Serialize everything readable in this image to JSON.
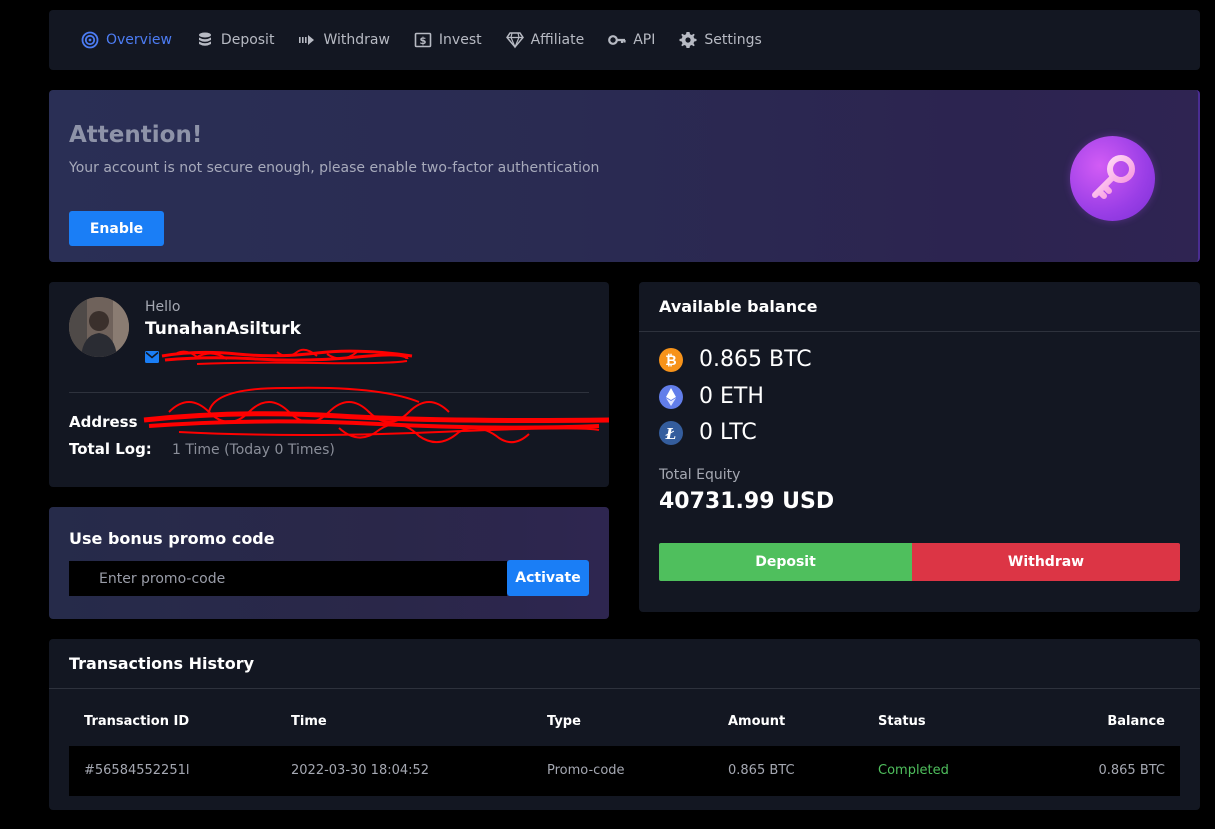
{
  "nav": {
    "items": [
      {
        "label": "Overview",
        "icon": "target-icon",
        "active": true
      },
      {
        "label": "Deposit",
        "icon": "database-icon"
      },
      {
        "label": "Withdraw",
        "icon": "withdraw-arrow-icon"
      },
      {
        "label": "Invest",
        "icon": "dollar-bill-icon"
      },
      {
        "label": "Affiliate",
        "icon": "diamond-icon"
      },
      {
        "label": "API",
        "icon": "key-icon"
      },
      {
        "label": "Settings",
        "icon": "gear-icon"
      }
    ]
  },
  "attention": {
    "title": "Attention!",
    "message": "Your account is not secure enough, please enable two-factor authentication",
    "button": "Enable",
    "badge_icon": "key-icon"
  },
  "profile": {
    "greeting": "Hello",
    "username": "TunahanAsilturk",
    "address_label": "Address",
    "total_log_label": "Total Log:",
    "total_log_value": "1 Time (Today 0 Times)"
  },
  "promo": {
    "title": "Use bonus promo code",
    "placeholder": "Enter promo-code",
    "button": "Activate"
  },
  "balance": {
    "title": "Available balance",
    "coins": [
      {
        "symbol": "BTC",
        "value": "0.865 BTC",
        "color": "#f7931a"
      },
      {
        "symbol": "ETH",
        "value": "0 ETH",
        "color": "#627eea"
      },
      {
        "symbol": "LTC",
        "value": "0 LTC",
        "color": "#345d9d"
      }
    ],
    "equity_label": "Total Equity",
    "equity_value": "40731.99 USD",
    "deposit_button": "Deposit",
    "withdraw_button": "Withdraw"
  },
  "transactions": {
    "title": "Transactions History",
    "columns": [
      "Transaction ID",
      "Time",
      "Type",
      "Amount",
      "Status",
      "Balance"
    ],
    "rows": [
      [
        "#56584552251l",
        "2022-03-30 18:04:52",
        "Promo-code",
        "0.865 BTC",
        "Completed",
        "0.865 BTC"
      ]
    ],
    "status_color": "#4fbf5d"
  }
}
